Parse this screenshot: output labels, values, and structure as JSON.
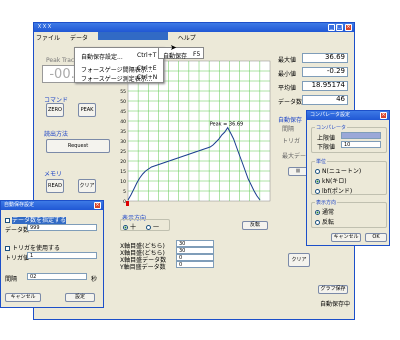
{
  "main_window": {
    "title": "ＸＸＸ",
    "menu": [
      "ファイル",
      "データ",
      "",
      "ヘルプ"
    ],
    "peak_label": "Peak",
    "track_label": "Track",
    "big_value": "-00.0",
    "stat_labels": [
      "最大値",
      "最小値",
      "平均値",
      "データ数"
    ],
    "stat_values": [
      "36.69",
      "-0.29",
      "18.95174",
      "46"
    ],
    "control_section": "コマンド",
    "zero_btn": "ZERO",
    "peak_btn": "PEAK",
    "request_section": "読出方法",
    "request_btn": "Request",
    "memory_section": "メモリ",
    "read_btn": "READ",
    "clear_btn": "クリア",
    "auto_save_title": "自動保存",
    "auto_rows": [
      "間隔",
      "トリガ",
      "",
      "最大データ数"
    ],
    "tick_peak": "Peak = 36.69",
    "display_dir_label": "表示方向",
    "display_dir_radios": [
      "十",
      "一"
    ],
    "reverse_btn": "反転",
    "bottom_labels": [
      "X軸目盛(どちら)",
      "X軸目盛(どちら)",
      "X軸目盛データ数",
      "Y軸目盛データ数"
    ],
    "bottom_values": [
      "30",
      "30",
      "0",
      "0"
    ],
    "clear_btn2": "クリア",
    "graph_save_btn": "グラフ保存",
    "status_text": "自動保存中"
  },
  "dropdown": {
    "items": [
      "自動保存設定...",
      "フォースゲージ間隔表示...",
      "フォースゲージ測定表示..."
    ],
    "shortcuts": [
      "Ctrl+T",
      "Ctrl+E",
      "Ctrl+N"
    ],
    "submenu": "自動保存",
    "submenu_shortcut": "F5"
  },
  "chart_data": {
    "type": "line",
    "ylim": [
      0,
      70
    ],
    "yticks": [
      "70",
      "65",
      "60",
      "55",
      "50",
      "45",
      "40",
      "35",
      "30",
      "25",
      "20",
      "15",
      "10",
      "5",
      "0"
    ],
    "xlim": [
      0,
      46
    ],
    "values": [
      0.5,
      3,
      6,
      9,
      11.5,
      13.5,
      15,
      16,
      17,
      17.5,
      18,
      18.5,
      19,
      19.5,
      20,
      20.5,
      21,
      21.5,
      22,
      22.5,
      23,
      23.5,
      24,
      24.5,
      25,
      25.5,
      26,
      26.5,
      27,
      28,
      29.5,
      31,
      33,
      34.5,
      36.69,
      34,
      31,
      27,
      23,
      19,
      15,
      11,
      8,
      5,
      2.5,
      0.5
    ],
    "annotation": "Peak = 36.69",
    "grid": true
  },
  "auto_dialog": {
    "title": "自動保存設定",
    "chk1": "データ数を指定する",
    "data_count_label": "データ数",
    "data_count_value": "999",
    "chk2": "トリガを使用する",
    "trigger_label": "トリガ値",
    "trigger_value": "1",
    "interval_label": "間隔",
    "interval_value": "02",
    "interval_unit": "秒",
    "cancel_btn": "キャンセル",
    "ok_btn": "設定"
  },
  "comp_dialog": {
    "title": "コンパレータ設定",
    "comp_group": "コンパレータ",
    "upper_label": "上限値",
    "lower_label": "下限値",
    "lower_value": "10",
    "unit_group": "単位",
    "units": [
      "N(ニュートン)",
      "kN(キロ)",
      "lbf(ポンド)"
    ],
    "dir_group": "表示方向",
    "dirs": [
      "通常",
      "反転"
    ],
    "cancel_btn": "キャンセル",
    "ok_btn": "OK"
  }
}
